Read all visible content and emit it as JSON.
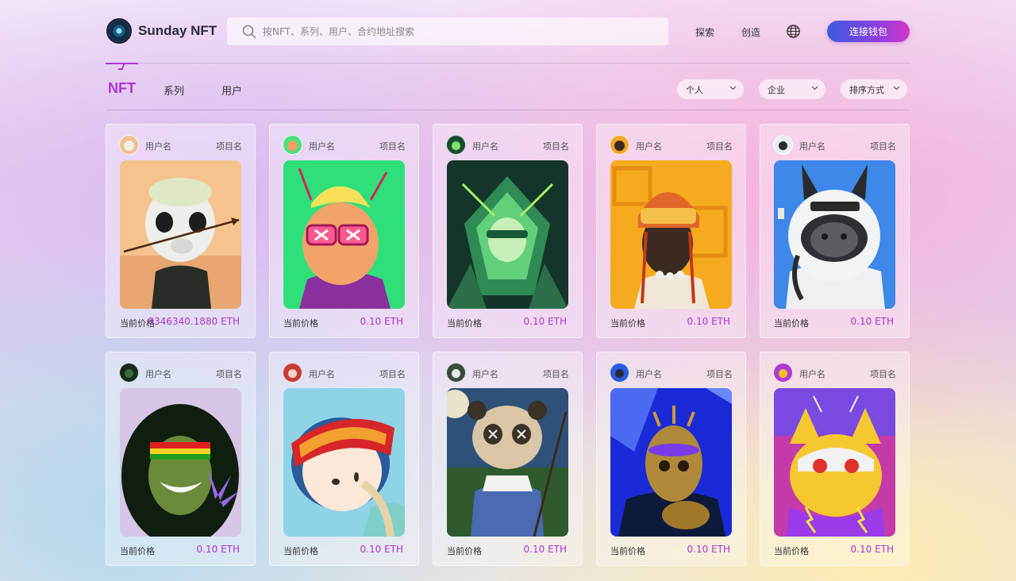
{
  "app": {
    "name": "Sunday NFT"
  },
  "search": {
    "placeholder": "按NFT、系列、用户、合约地址搜索"
  },
  "nav": {
    "explore": "探索",
    "create": "创造",
    "language_icon": "globe-icon",
    "connect_wallet": "连接钱包"
  },
  "tabs": {
    "nft": "NFT",
    "series": "系列",
    "users": "用户"
  },
  "filters": {
    "personal": "个人",
    "enterprise": "企业",
    "sort": "排序方式"
  },
  "colors": {
    "accent": "#b033d6",
    "button_gradient": [
      "#3d5ae0",
      "#8b3fe0",
      "#d235c8"
    ]
  },
  "cards": [
    {
      "user": "用户名",
      "project": "项目名",
      "price_label": "当前价格",
      "price": "8346340.1880 ETH",
      "art": "white-cat-with-arrow"
    },
    {
      "user": "用户名",
      "project": "项目名",
      "price_label": "当前价格",
      "price": "0.10 ETH",
      "art": "ape-with-goggles"
    },
    {
      "user": "用户名",
      "project": "项目名",
      "price_label": "当前价格",
      "price": "0.10 ETH",
      "art": "green-insect-warrior"
    },
    {
      "user": "用户名",
      "project": "项目名",
      "price_label": "当前价格",
      "price": "0.10 ETH",
      "art": "helmet-figure-orange"
    },
    {
      "user": "用户名",
      "project": "项目名",
      "price_label": "当前价格",
      "price": "0.10 ETH",
      "art": "astronaut-dog-2022"
    },
    {
      "user": "用户名",
      "project": "项目名",
      "price_label": "当前价格",
      "price": "0.10 ETH",
      "art": "rasta-portrait"
    },
    {
      "user": "用户名",
      "project": "项目名",
      "price_label": "当前价格",
      "price": "0.10 ETH",
      "art": "ski-goggles-girl"
    },
    {
      "user": "用户名",
      "project": "项目名",
      "price_label": "当前价格",
      "price": "0.10 ETH",
      "art": "panda-farmer"
    },
    {
      "user": "用户名",
      "project": "项目名",
      "price_label": "当前价格",
      "price": "0.10 ETH",
      "art": "golden-skull-blue"
    },
    {
      "user": "用户名",
      "project": "项目名",
      "price_label": "当前价格",
      "price": "0.10 ETH",
      "art": "tiger-cat-neon"
    }
  ]
}
